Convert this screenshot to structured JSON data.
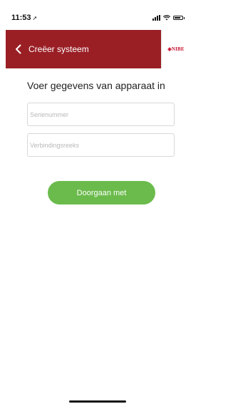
{
  "status_bar": {
    "time": "11:53",
    "location_glyph": "➚"
  },
  "header": {
    "back_label": "Creëer systeem",
    "logo_text": "◈NIBE",
    "color": "#9a1f25"
  },
  "main": {
    "title": "Voer gegevens van apparaat in",
    "serial": {
      "value": "",
      "placeholder": "Serienummer"
    },
    "connection": {
      "value": "",
      "placeholder": "Verbindingsreeks"
    },
    "continue_label": "Doorgaan met",
    "accent": "#6bbb4c"
  }
}
